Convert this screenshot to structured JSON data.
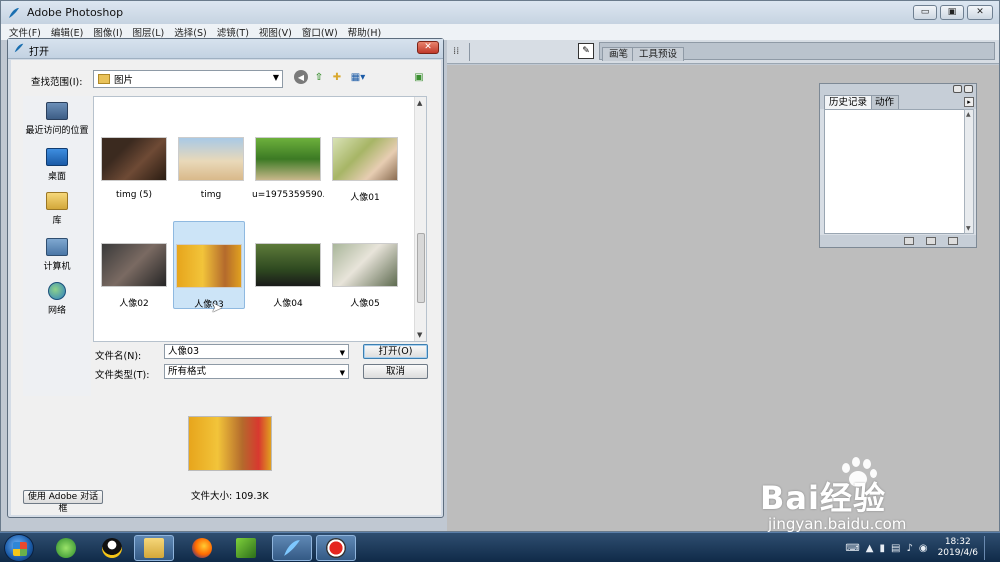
{
  "app": {
    "title": "Adobe Photoshop",
    "window_buttons": {
      "minimize": "▭",
      "restore": "▣",
      "close": "✕"
    }
  },
  "menu": [
    "文件(F)",
    "编辑(E)",
    "图像(I)",
    "图层(L)",
    "选择(S)",
    "滤镜(T)",
    "视图(V)",
    "窗口(W)",
    "帮助(H)"
  ],
  "palette_well": {
    "tabs": [
      "画笔",
      "工具预设"
    ]
  },
  "history_panel": {
    "tabs": [
      "历史记录",
      "动作"
    ]
  },
  "dialog": {
    "title": "打开",
    "look_in_label": "查找范围(I):",
    "look_in_value": "图片",
    "places": [
      {
        "label": "最近访问的位置",
        "icon": "recent-places-icon"
      },
      {
        "label": "桌面",
        "icon": "desktop-icon"
      },
      {
        "label": "库",
        "icon": "library-icon"
      },
      {
        "label": "计算机",
        "icon": "computer-icon"
      },
      {
        "label": "网络",
        "icon": "network-icon"
      }
    ],
    "files": [
      {
        "name": "timg (5)"
      },
      {
        "name": "timg"
      },
      {
        "name": "u=1975359590..."
      },
      {
        "name": "人像01"
      },
      {
        "name": "人像02"
      },
      {
        "name": "人像03"
      },
      {
        "name": "人像04"
      },
      {
        "name": "人像05"
      }
    ],
    "selected_file": "人像03",
    "file_name_label": "文件名(N):",
    "file_name_value": "人像03",
    "file_type_label": "文件类型(T):",
    "file_type_value": "所有格式",
    "open_button": "打开(O)",
    "cancel_button": "取消",
    "file_size": "文件大小: 109.3K",
    "adobe_dialog_button": "使用 Adobe 对话框"
  },
  "taskbar": {
    "clock_time": "18:32",
    "clock_date": "2019/4/6"
  },
  "watermark": {
    "brand": "Bai经验",
    "url": "jingyan.baidu.com"
  },
  "colors": {
    "accent": "#3c7fb1",
    "selection": "#cce4f7",
    "taskbar": "#1d3f60",
    "canvas": "#bdbdbd"
  }
}
